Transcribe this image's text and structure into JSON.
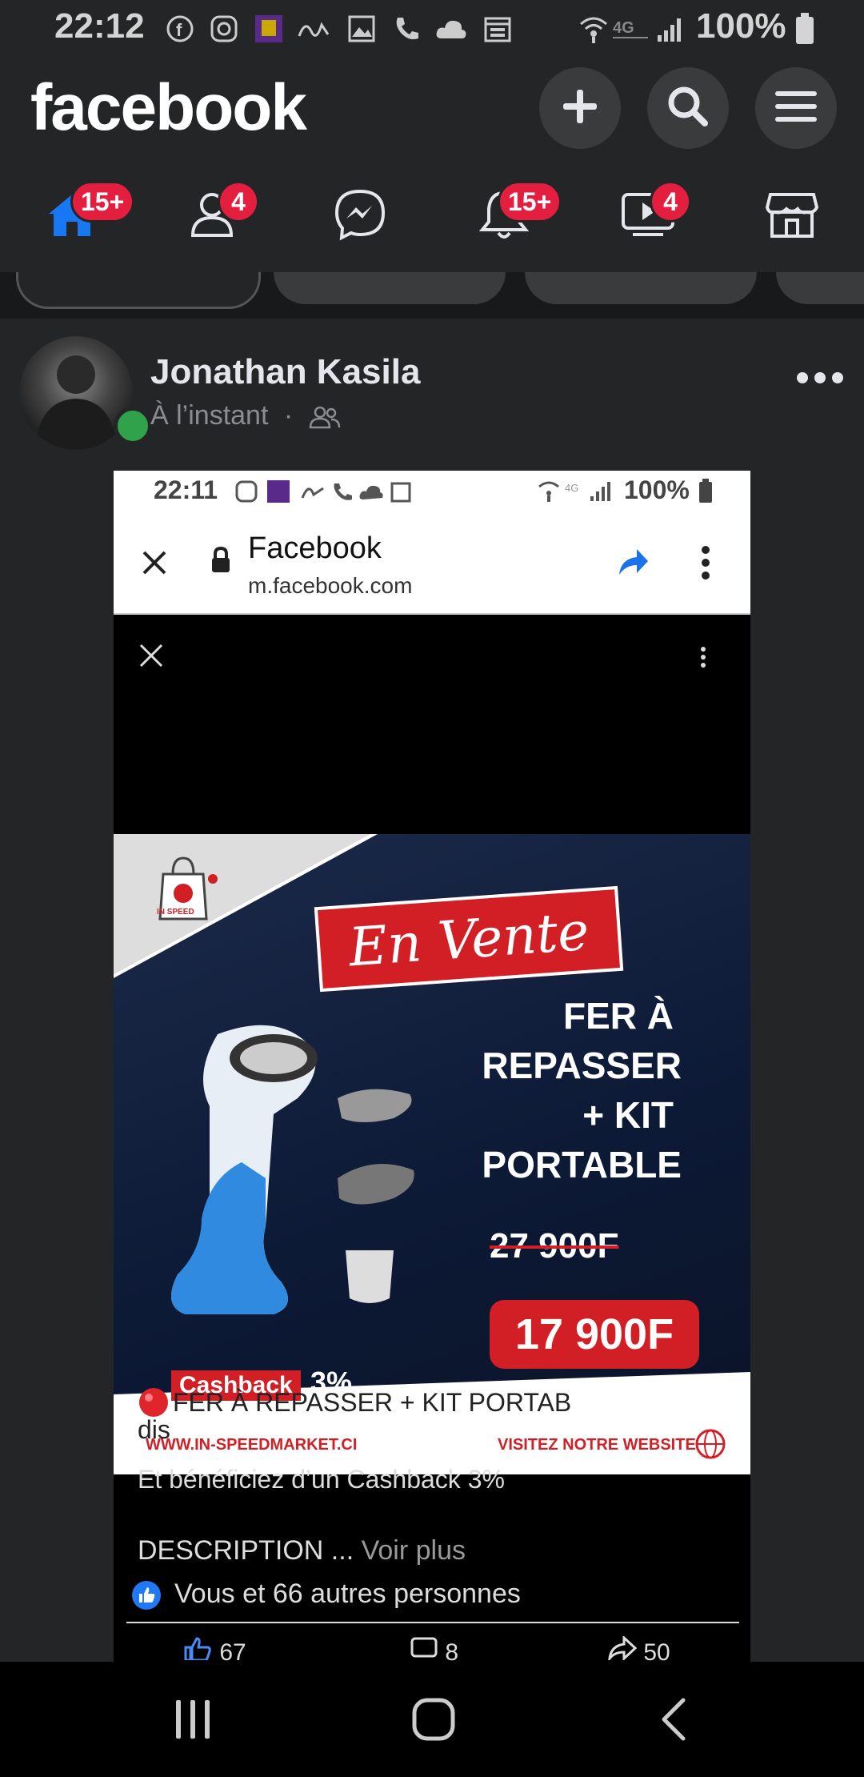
{
  "status_bar": {
    "time": "22:12",
    "battery": "100%",
    "icons": [
      "facebook-icon",
      "instagram-icon",
      "app-icon",
      "signature-icon",
      "gallery-icon",
      "phone-icon",
      "cloud-icon",
      "calendar-icon",
      "wifi-icon",
      "4g-icon",
      "signal-icon",
      "battery-icon"
    ]
  },
  "header": {
    "logo": "facebook",
    "buttons": [
      "plus-icon",
      "search-icon",
      "menu-icon"
    ]
  },
  "nav": {
    "items": [
      {
        "name": "home",
        "badge": "15+"
      },
      {
        "name": "friends",
        "badge": "4"
      },
      {
        "name": "messenger",
        "badge": ""
      },
      {
        "name": "notifications",
        "badge": "15+"
      },
      {
        "name": "watch",
        "badge": "4"
      },
      {
        "name": "marketplace",
        "badge": ""
      }
    ],
    "accent": "#1877f2",
    "badge_color": "#e41e3f"
  },
  "post": {
    "author": "Jonathan Kasila",
    "timestamp": "À l’instant",
    "audience_icon": "friends-icon",
    "embedded": {
      "status_time": "22:11",
      "status_battery": "100%",
      "browser_title": "Facebook",
      "browser_url": "m.facebook.com",
      "ad": {
        "brand": "IN SPEED",
        "banner": "En Vente",
        "line1": "FER À",
        "line2": "REPASSER",
        "line3": "+ KIT",
        "line4": "PORTABLE",
        "old_price": "27 900F",
        "new_price": "17 900F",
        "cashback_label": "Cashback",
        "cashback_pct": "3%",
        "website": "WWW.IN-SPEEDMARKET.CI",
        "visit": "VISITEZ NOTRE WEBSITE"
      },
      "caption_line1": "FER À REPASSER + KIT PORTAB",
      "caption_line2": "dis",
      "caption_line3": "Et bénéficiez d’un Cashback 3%",
      "description": "DESCRIPTION ...",
      "see_more": "Voir plus",
      "reactions_text": "Vous et 66 autres personnes",
      "likes": "67",
      "comments": "8",
      "shares": "50"
    }
  }
}
